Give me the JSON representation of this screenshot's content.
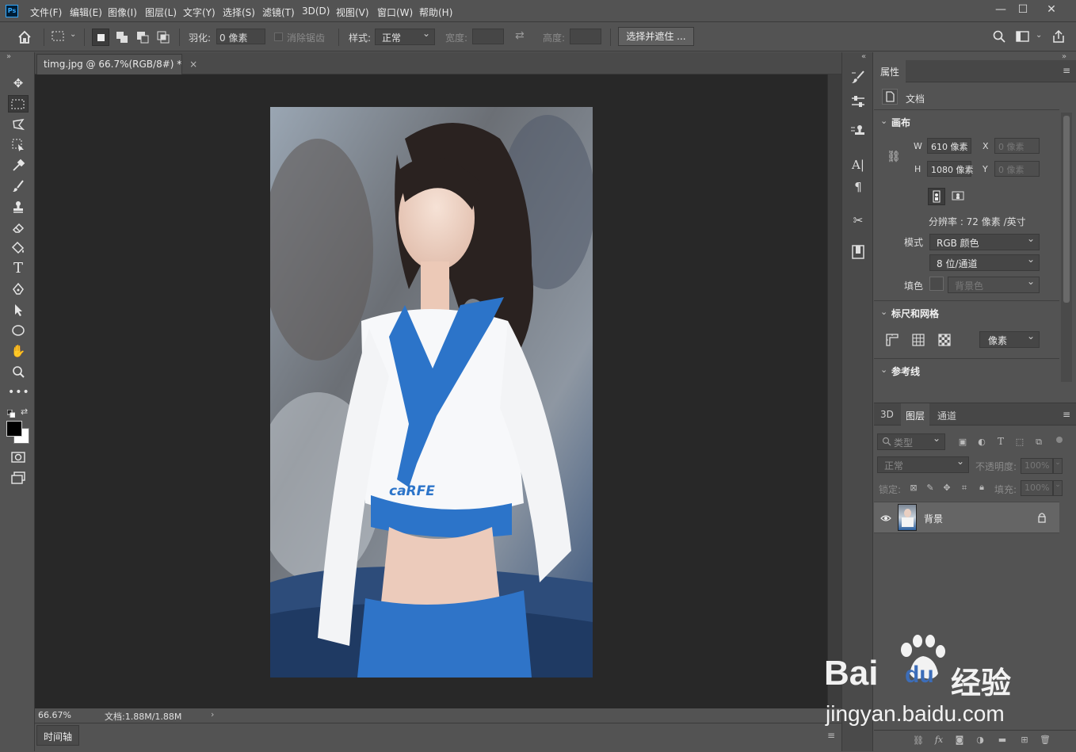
{
  "app": {
    "logo": "Ps",
    "accent": "#31a8ff"
  },
  "menu": [
    "文件(F)",
    "编辑(E)",
    "图像(I)",
    "图层(L)",
    "文字(Y)",
    "选择(S)",
    "滤镜(T)",
    "3D(D)",
    "视图(V)",
    "窗口(W)",
    "帮助(H)"
  ],
  "window_controls": {
    "min": "—",
    "max": "☐",
    "close": "✕"
  },
  "options": {
    "feather_label": "羽化:",
    "feather_value": "0 像素",
    "antialias_label": "消除锯齿",
    "style_label": "样式:",
    "style_value": "正常",
    "width_label": "宽度:",
    "height_label": "高度:",
    "select_mask_button": "选择并遮住 ..."
  },
  "document": {
    "tab_title": "timg.jpg @ 66.7%(RGB/8#) *",
    "close_glyph": "×",
    "zoom": "66.67%",
    "doc_size": "文档:1.88M/1.88M",
    "shirt_text": "caRFE"
  },
  "timeline_tab": "时间轴",
  "properties": {
    "tab": "属性",
    "doc_label": "文档",
    "canvas_section": "画布",
    "w_label": "W",
    "w_value": "610 像素",
    "h_label": "H",
    "h_value": "1080 像素",
    "x_label": "X",
    "x_value": "0 像素",
    "y_label": "Y",
    "y_value": "0 像素",
    "resolution": "分辨率 : 72 像素 /英寸",
    "mode_label": "模式",
    "mode_value": "RGB 颜色",
    "bit_value": "8 位/通道",
    "fill_label": "填色",
    "fill_value": "背景色",
    "rulers_section": "标尺和网格",
    "unit_value": "像素",
    "guides_section": "参考线"
  },
  "layers_panel": {
    "tabs": [
      "3D",
      "图层",
      "通道"
    ],
    "active_tab": "图层",
    "filter_kind": "类型",
    "blend_mode": "正常",
    "opacity_label": "不透明度:",
    "opacity_value": "100%",
    "lock_label": "锁定:",
    "fill_label": "填充:",
    "fill_value": "100%",
    "layers": [
      {
        "name": "背景",
        "visible": true,
        "locked": true
      }
    ]
  },
  "watermark": {
    "brand": "Bai",
    "brand2": "du",
    "product": "经验",
    "url": "jingyan.baidu.com"
  }
}
